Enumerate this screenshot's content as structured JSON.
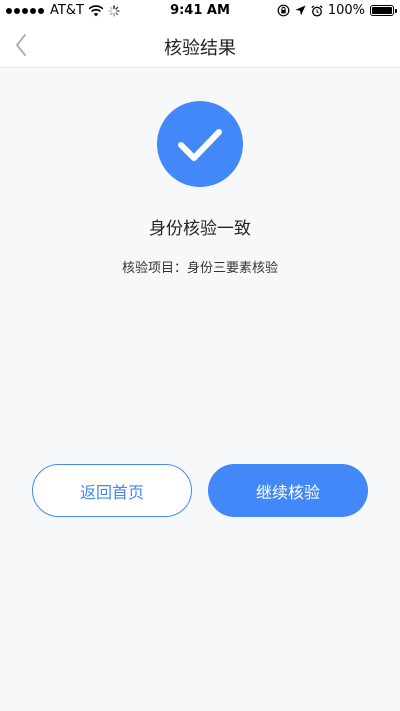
{
  "status_bar": {
    "carrier": "AT&T",
    "time": "9:41 AM",
    "battery": "100%",
    "battery_level": 1.0
  },
  "nav": {
    "title": "核验结果",
    "back_icon": "chevron-left-icon"
  },
  "result": {
    "icon": "check-circle-icon",
    "title": "身份核验一致",
    "detail": "核验项目：身份三要素核验"
  },
  "actions": {
    "back_home_label": "返回首页",
    "continue_label": "继续核验"
  },
  "colors": {
    "accent": "#4388f8",
    "background": "#f7f8fa"
  }
}
